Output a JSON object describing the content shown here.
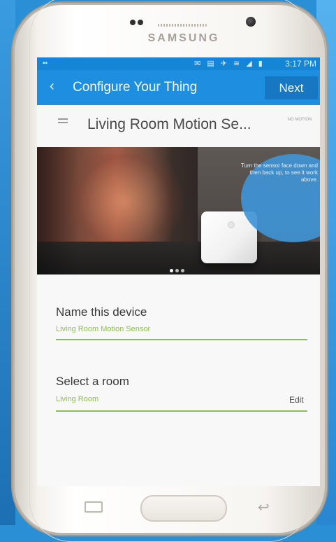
{
  "device_frame": {
    "brand": "SAMSUNG"
  },
  "status_bar": {
    "left_indicator": "▪▪",
    "icons": "✉ ▤ ✈ ≋ ◢ ▮",
    "time": "3:17 PM"
  },
  "app_bar": {
    "back_icon": "back-arrow-icon",
    "title": "Configure Your Thing",
    "next_label": "Next"
  },
  "device_header": {
    "title": "Living Room Motion Se...",
    "status_badge": "NO MOTION"
  },
  "banner": {
    "hint": "Turn the sensor face down and then back up, to see it work above.",
    "pager_total": 3,
    "pager_active": 1
  },
  "form": {
    "name_label": "Name this device",
    "name_value": "Living Room Motion Sensor",
    "room_label": "Select a room",
    "room_value": "Living Room",
    "edit_label": "Edit"
  },
  "colors": {
    "primary_blue": "#1e8ee0",
    "accent_green": "#8bc34a"
  },
  "nav": {
    "recent_icon": "recent-apps-icon",
    "home_icon": "home-button",
    "back_icon": "back-icon"
  }
}
